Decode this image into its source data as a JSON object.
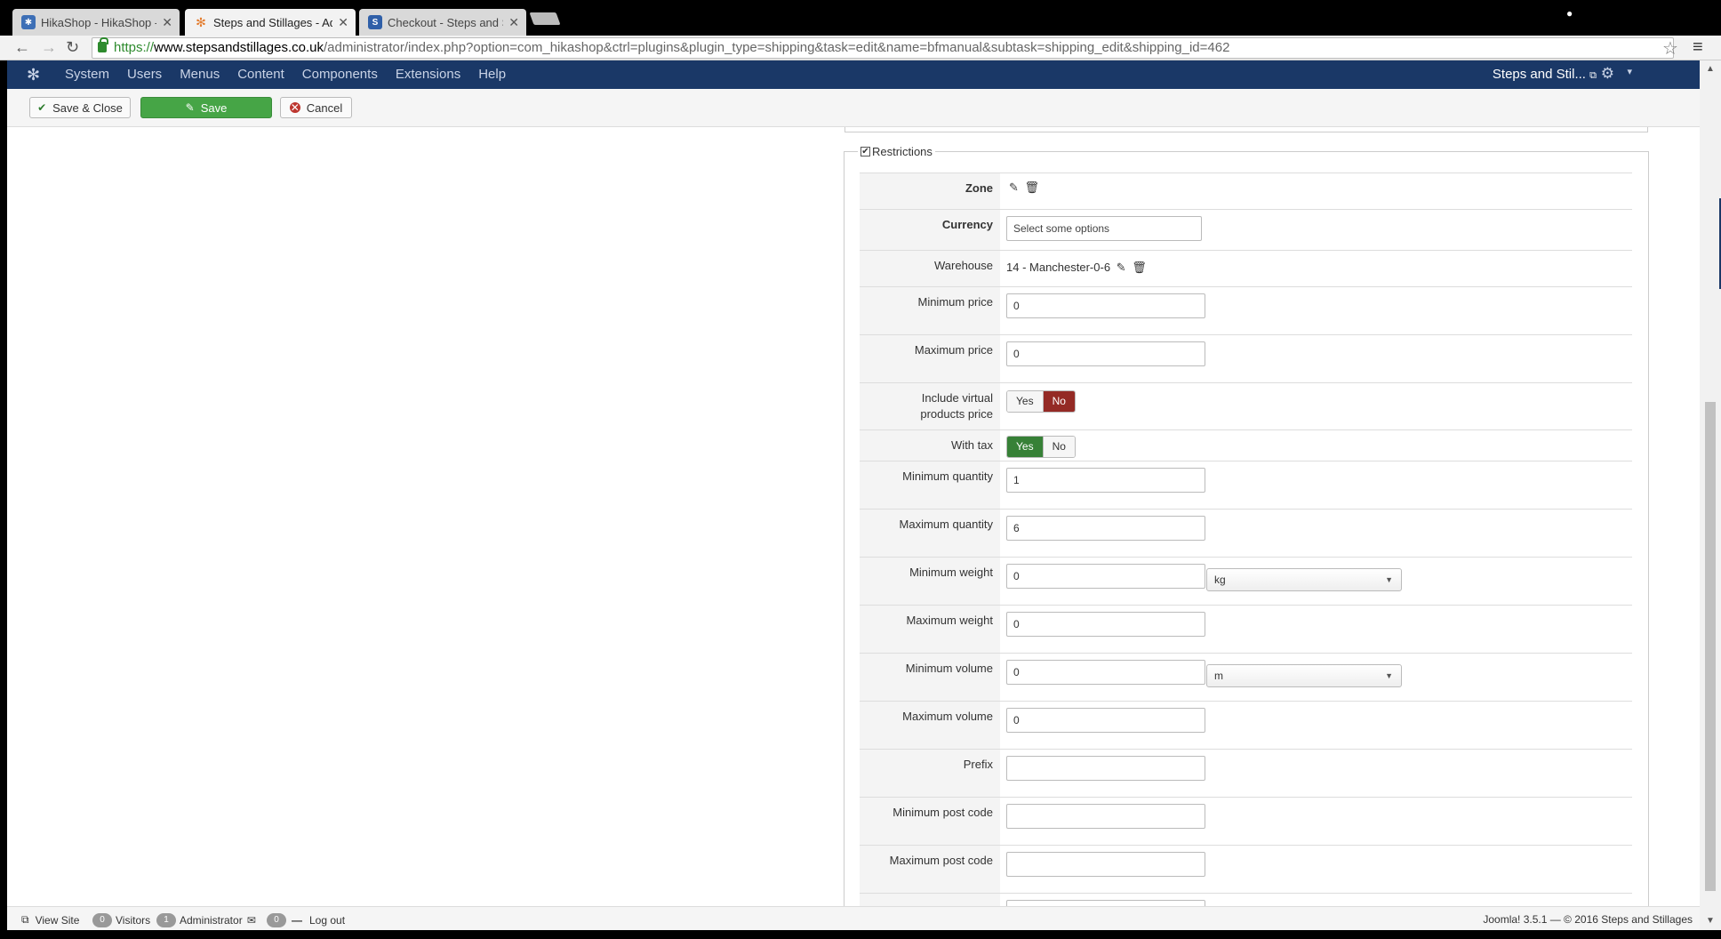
{
  "browser": {
    "tabs": [
      {
        "title": "HikaShop - HikaShop - To",
        "favicon": "hikashop",
        "active": false
      },
      {
        "title": "Steps and Stillages - Adm",
        "favicon": "joomla",
        "active": true
      },
      {
        "title": "Checkout - Steps and Still",
        "favicon": "ss",
        "active": false
      }
    ],
    "url_scheme": "https://",
    "url_host": "www.stepsandstillages.co.uk",
    "url_path": "/administrator/index.php?option=com_hikashop&ctrl=plugins&plugin_type=shipping&task=edit&name=bfmanual&subtask=shipping_edit&shipping_id=462"
  },
  "nav": {
    "items": [
      "System",
      "Users",
      "Menus",
      "Content",
      "Components",
      "Extensions",
      "Help"
    ],
    "site_name": "Steps and Stil...",
    "brand_color": "#1a3867"
  },
  "toolbar": {
    "save_close": "Save & Close",
    "save": "Save",
    "cancel": "Cancel"
  },
  "restrictions": {
    "legend": "Restrictions",
    "checked": true,
    "zone_label": "Zone",
    "currency_label": "Currency",
    "currency_placeholder": "Select some options",
    "warehouse_label": "Warehouse",
    "warehouse_value": "14 - Manchester-0-6",
    "min_price_label": "Minimum price",
    "min_price": "0",
    "max_price_label": "Maximum price",
    "max_price": "0",
    "virtual_label_1": "Include virtual",
    "virtual_label_2": "products price",
    "virtual_yes": "Yes",
    "virtual_no": "No",
    "virtual_selected": "No",
    "with_tax_label": "With tax",
    "with_tax_yes": "Yes",
    "with_tax_no": "No",
    "with_tax_selected": "Yes",
    "min_qty_label": "Minimum quantity",
    "min_qty": "1",
    "max_qty_label": "Maximum quantity",
    "max_qty": "6",
    "min_weight_label": "Minimum weight",
    "min_weight": "0",
    "weight_unit": "kg",
    "max_weight_label": "Maximum weight",
    "max_weight": "0",
    "min_volume_label": "Minimum volume",
    "min_volume": "0",
    "volume_unit": "m",
    "max_volume_label": "Maximum volume",
    "max_volume": "0",
    "prefix_label": "Prefix",
    "prefix": "",
    "min_post_label": "Minimum post code",
    "min_post": "",
    "max_post_label": "Maximum post code",
    "max_post": ""
  },
  "status": {
    "view_site": "View Site",
    "visitors_count": "0",
    "visitors": "Visitors",
    "admin_count": "1",
    "administrator": "Administrator",
    "messages_count": "0",
    "logout": "Log out",
    "footer": "Joomla! 3.5.1 — © 2016 Steps and Stillages"
  }
}
